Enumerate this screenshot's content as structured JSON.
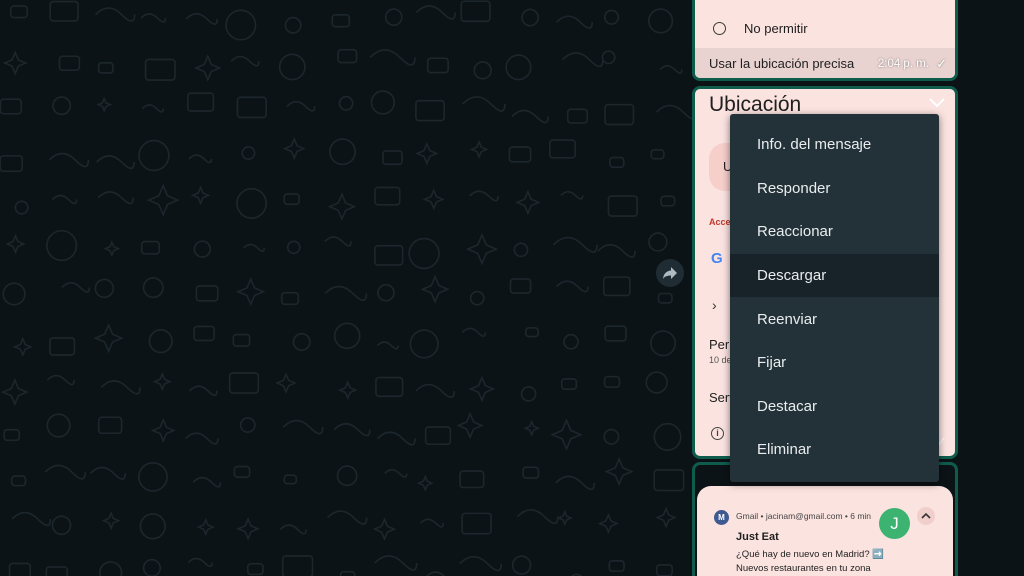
{
  "bubble_top": {
    "option_label": "No permitir",
    "footer_text": "Usar la ubicación precisa",
    "time": "2:04 p. m."
  },
  "bubble_location": {
    "title": "Ubicación",
    "pill_text": "U",
    "section_label": "Acce",
    "google_letter": "G",
    "perm_label": "Perr",
    "perm_sub": "10 de",
    "serv_label": "Serv"
  },
  "bubble_notification": {
    "app_line": "Gmail • jacinam@gmail.com • 6 min",
    "avatar_letter": "J",
    "subject": "Just Eat",
    "body_line_1": "¿Qué hay de nuevo en Madrid? ➡️",
    "body_line_2": "Nuevos restaurantes en tu zona"
  },
  "context_menu": {
    "items": [
      {
        "label": "Info. del mensaje"
      },
      {
        "label": "Responder"
      },
      {
        "label": "Reaccionar"
      },
      {
        "label": "Descargar"
      },
      {
        "label": "Reenviar"
      },
      {
        "label": "Fijar"
      },
      {
        "label": "Destacar"
      },
      {
        "label": "Eliminar"
      }
    ],
    "hovered_index": 3
  },
  "colors": {
    "background": "#0c1317",
    "menu_bg": "#233138",
    "menu_hover": "#182229",
    "bubble_border": "#0f5c4d",
    "bubble_bg": "#fbe3e0"
  }
}
